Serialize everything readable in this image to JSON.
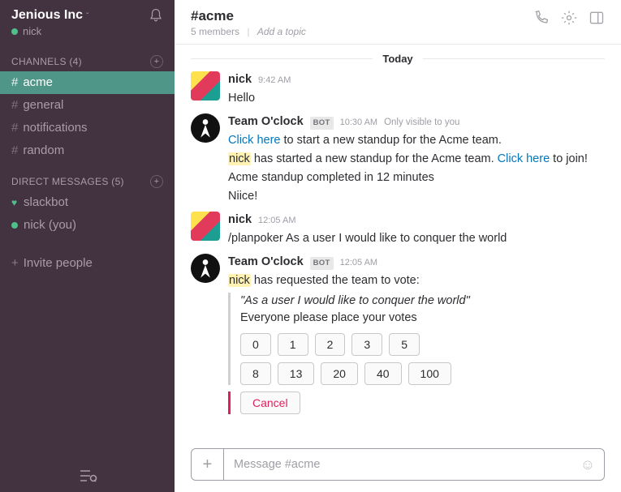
{
  "sidebar": {
    "team_name": "Jenious Inc",
    "current_user": "nick",
    "channels_label": "CHANNELS",
    "channels_count": "(4)",
    "channels": [
      {
        "name": "acme",
        "active": true
      },
      {
        "name": "general",
        "active": false
      },
      {
        "name": "notifications",
        "active": false
      },
      {
        "name": "random",
        "active": false
      }
    ],
    "dm_label": "DIRECT MESSAGES",
    "dm_count": "(5)",
    "dms": [
      {
        "name": "slackbot",
        "presence": "heart"
      },
      {
        "name": "nick (you)",
        "presence": "dot"
      }
    ],
    "invite_label": "Invite people"
  },
  "header": {
    "channel": "#acme",
    "members": "5 members",
    "add_topic": "Add a topic"
  },
  "day_label": "Today",
  "messages": [
    {
      "kind": "user",
      "name": "nick",
      "time": "9:42 AM",
      "text": "Hello"
    },
    {
      "kind": "bot",
      "name": "Team O'clock",
      "time": "10:30 AM",
      "only": "Only visible to you",
      "lines": [
        {
          "parts": [
            {
              "link": "Click here"
            },
            {
              "t": " to start a new standup for the Acme team."
            }
          ]
        },
        {
          "parts": [
            {
              "hl": "nick"
            },
            {
              "t": " has started a new standup for the Acme team. "
            },
            {
              "link": "Click here"
            },
            {
              "t": " to join!"
            }
          ]
        },
        {
          "parts": [
            {
              "t": "Acme standup completed in 12 minutes"
            }
          ]
        },
        {
          "parts": [
            {
              "t": "Niice!"
            }
          ]
        }
      ]
    },
    {
      "kind": "user",
      "name": "nick",
      "time": "12:05 AM",
      "text": "/planpoker As a user I would like to conquer the world"
    },
    {
      "kind": "bot",
      "name": "Team O'clock",
      "time": "12:05 AM",
      "lines": [
        {
          "parts": [
            {
              "hl": "nick"
            },
            {
              "t": " has requested the team to vote:"
            }
          ]
        }
      ],
      "attachment": {
        "quote": "\"As a user I would like to conquer the world\"",
        "plain": "Everyone please place your votes",
        "buttons_row1": [
          "0",
          "1",
          "2",
          "3",
          "5"
        ],
        "buttons_row2": [
          "8",
          "13",
          "20",
          "40",
          "100"
        ],
        "cancel": "Cancel"
      }
    }
  ],
  "composer": {
    "placeholder": "Message #acme"
  }
}
